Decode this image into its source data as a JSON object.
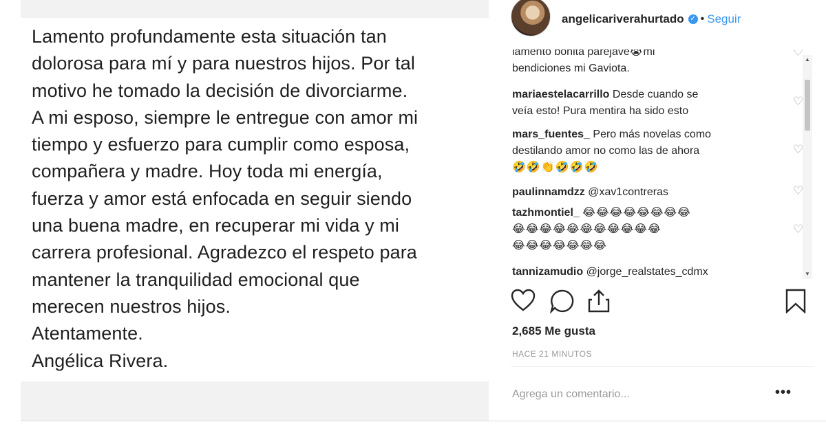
{
  "post": {
    "lines": [
      "Lamento profundamente esta situación tan",
      "dolorosa para mí y para nuestros hijos. Por tal",
      "motivo he tomado la decisión de divorciarme.",
      "A mi esposo, siempre le entregue con amor mi",
      "tiempo y esfuerzo para cumplir como esposa,",
      "compañera y madre. Hoy toda mi energía,",
      "fuerza y amor está enfocada en seguir siendo",
      "una buena madre, en recuperar mi vida y mi",
      "carrera profesional. Agradezco el respeto para",
      "mantener la tranquilidad emocional que",
      "merecen nuestros hijos.",
      "Atentamente.",
      "Angélica Rivera."
    ]
  },
  "header": {
    "username": "angelicariverahurtado",
    "verified_glyph": "✓",
    "separator": "•",
    "follow_label": "Seguir"
  },
  "comments": [
    {
      "user": "",
      "text": "lamento bonita parejave",
      "extra": "mi"
    },
    {
      "user": "",
      "text": "bendiciones mi Gaviota."
    },
    {
      "user": "mariaestelacarrillo",
      "text": "Desde cuando se",
      "text2": "veía esto! Pura mentira ha sido esto"
    },
    {
      "user": "mars_fuentes_",
      "text": "Pero más novelas como",
      "text2": "destilando amor no como las de ahora",
      "emoji": "🤣🤣👏🤣🤣🤣"
    },
    {
      "user": "paulinnamdzz",
      "text": "@xav1contreras"
    },
    {
      "user": "tazhmontiel_",
      "emoji1": "😂😂😂😂😂😂😂😂",
      "emoji2": "😂😂😂😂😂😂😂😂😂😂😂",
      "emoji3": "😂😂😂😂😂😂😂"
    },
    {
      "user": "tannizamudio",
      "text": "@jorge_realstates_cdmx"
    }
  ],
  "footer": {
    "likes": "2,685 Me gusta",
    "time": "HACE 21 MINUTOS",
    "add_comment_placeholder": "Agrega un comentario...",
    "more_glyph": "•••"
  },
  "icons": [
    "heart-icon",
    "comment-icon",
    "share-icon",
    "bookmark-icon",
    "verified-icon",
    "heart-small-icon",
    "scroll-up-icon",
    "scroll-down-icon"
  ]
}
